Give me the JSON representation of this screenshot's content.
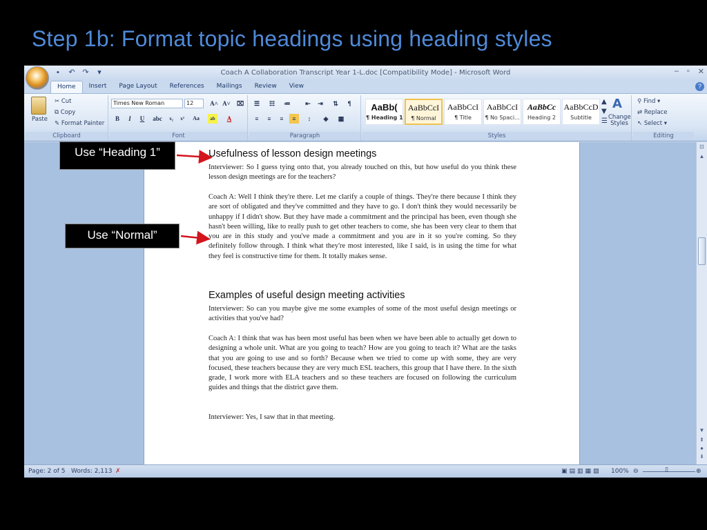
{
  "slide": {
    "title": "Step 1b: Format topic headings using heading styles"
  },
  "window": {
    "title": "Coach A Collaboration Transcript Year 1-L.doc [Compatibility Mode] - Microsoft Word",
    "controls": [
      "–",
      "▫",
      "✕"
    ]
  },
  "tabs": [
    "Home",
    "Insert",
    "Page Layout",
    "References",
    "Mailings",
    "Review",
    "View"
  ],
  "ribbon": {
    "clipboard": {
      "paste": "Paste",
      "cut": "Cut",
      "copy": "Copy",
      "format_painter": "Format Painter",
      "label": "Clipboard"
    },
    "font": {
      "name": "Times New Roman",
      "size": "12",
      "label": "Font"
    },
    "paragraph": {
      "label": "Paragraph"
    },
    "styles": {
      "label": "Styles",
      "tiles": [
        {
          "sample": "AaBb(",
          "name": "¶ Heading 1"
        },
        {
          "sample": "AaBbCcI",
          "name": "¶ Normal"
        },
        {
          "sample": "AaBbCcI",
          "name": "¶ Title"
        },
        {
          "sample": "AaBbCcI",
          "name": "¶ No Spaci..."
        },
        {
          "sample": "AaBbCc",
          "name": "Heading 2"
        },
        {
          "sample": "AaBbCcD",
          "name": "Subtitle"
        }
      ],
      "change_styles": "Change Styles"
    },
    "editing": {
      "find": "Find",
      "replace": "Replace",
      "select": "Select",
      "label": "Editing"
    }
  },
  "document": {
    "heading1": "Usefulness of lesson design meetings",
    "p1": "Interviewer:  So I guess tying onto that, you already touched on this, but how useful do you think these lesson design meetings are for the teachers?",
    "p2": "Coach A: Well I think they're there.  Let me clarify a couple of things.  They're there because I think they are sort of obligated and they've committed and they have to go.  I don't think they would necessarily be unhappy if I didn't show.  But they have made a commitment and the principal has been, even though she hasn't been willing, like to really push to get other teachers to come, she has been very clear to them that you are in this study and you've made a commitment and you are in it so you're coming.  So they definitely follow through.  I think what they're most interested, like I said, is in using the time for what they feel is constructive time for them.  It totally makes sense.",
    "heading2": "Examples of useful design meeting activities",
    "p3": "Interviewer:  So can you maybe give me some examples of some of the most useful design meetings or activities that you've had?",
    "p4": "Coach A: I think that was has been most useful has been when we have been able to actually get down to designing a whole unit. What are you going to teach? How are you going to teach it?  What are the tasks that you are going to use and so forth?  Because when we tried to come up with some, they are very focused, these teachers because they are very much ESL teachers, this group that I have there.  In the sixth grade, I work more with ELA teachers and so these teachers are focused on following the curriculum guides and things that the district gave them.",
    "p5": "Interviewer:  Yes, I saw that in that meeting."
  },
  "statusbar": {
    "page": "Page: 2 of 5",
    "words": "Words: 2,113",
    "zoom": "100%"
  },
  "callouts": {
    "heading": "Use “Heading 1”",
    "normal": "Use “Normal”"
  },
  "colors": {
    "title_blue": "#4f8ad8",
    "arrow_red": "#d4141c",
    "ribbon_blue": "#c9d9ee"
  }
}
